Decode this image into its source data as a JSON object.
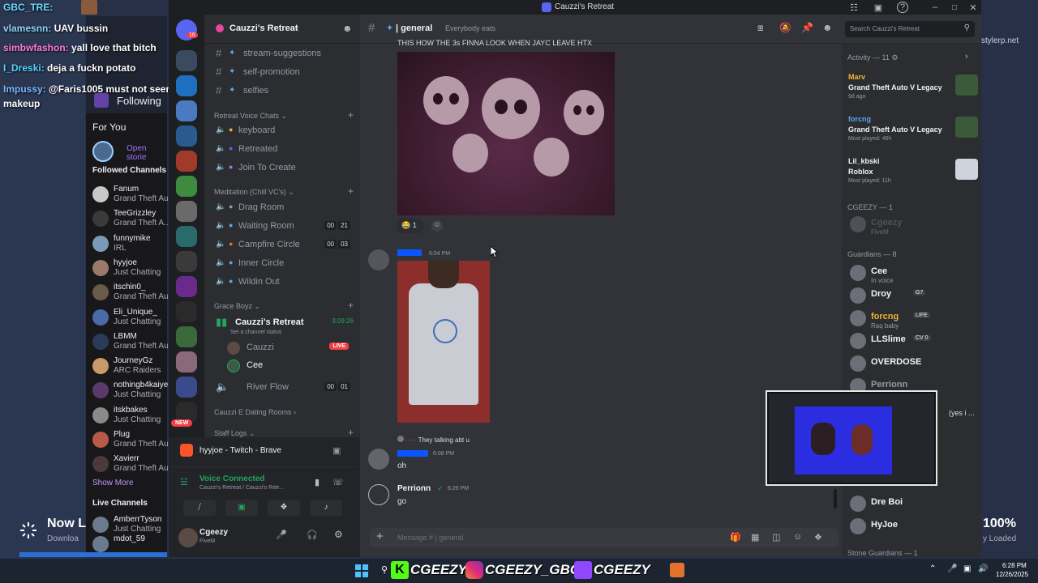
{
  "overlay_chat": [
    {
      "user": "GBC_TRE:",
      "msg": ""
    },
    {
      "user": "vlamesnn:",
      "msg": "UAV bussin"
    },
    {
      "user": "simbwfashon:",
      "msg": "yall love that bitch"
    },
    {
      "user": "I_Dreski:",
      "msg": "deja a fuckn potato"
    },
    {
      "user": "Impussy:",
      "msg": "@Faris1005 must not seen her without makeup"
    }
  ],
  "twitch": {
    "following_label": "Following",
    "for_you_label": "For You",
    "open_stories_label": "Open storie",
    "followed_channels_label": "Followed Channels",
    "channels": [
      {
        "name": "Fanum",
        "game": "Grand Theft Au"
      },
      {
        "name": "TeeGrizzley",
        "game": "Grand Theft A..."
      },
      {
        "name": "funnymike",
        "game": "IRL"
      },
      {
        "name": "hyyjoe",
        "game": "Just Chatting"
      },
      {
        "name": "itschin0_",
        "game": "Grand Theft Au"
      },
      {
        "name": "Eli_Unique_",
        "game": "Just Chatting"
      },
      {
        "name": "LBMM",
        "game": "Grand Theft Au"
      },
      {
        "name": "JourneyGz",
        "game": "ARC Raiders"
      },
      {
        "name": "nothingb4kaiye",
        "game": "Just Chatting"
      },
      {
        "name": "itskbakes",
        "game": "Just Chatting"
      },
      {
        "name": "Plug",
        "game": "Grand Theft Au"
      },
      {
        "name": "Xavierr",
        "game": "Grand Theft Au"
      }
    ],
    "show_more_label": "Show More",
    "live_channels_label": "Live Channels",
    "live_channels": [
      {
        "name": "AmberrTyson",
        "game": "Just Chatting"
      },
      {
        "name": "mdot_59",
        "game": ""
      }
    ],
    "now_live_label": "Now L",
    "download_label": "Downloa",
    "percent_label": "100%",
    "loaded_label": "y Loaded",
    "stylerp_label": "stylerp.net"
  },
  "window": {
    "title": "Cauzzi's Retreat"
  },
  "server": {
    "name": "Cauzzi's Retreat"
  },
  "guild_badge": "16",
  "new_badge": "NEW",
  "channels": {
    "top": [
      {
        "name": "stream-suggestions"
      },
      {
        "name": "self-promotion"
      },
      {
        "name": "selfies"
      }
    ],
    "cat_voice": "Retreat Voice Chats",
    "voice": [
      {
        "name": "keyboard"
      },
      {
        "name": "Retreated"
      },
      {
        "name": "Join To Create"
      }
    ],
    "cat_meditation": "Meditation (Chill VC's)",
    "meditation": [
      {
        "name": "Drag Room",
        "a": "",
        "b": ""
      },
      {
        "name": "Waiting Room",
        "a": "00",
        "b": "21"
      },
      {
        "name": "Campfire Circle",
        "a": "00",
        "b": "03"
      },
      {
        "name": "Inner Circle",
        "a": "",
        "b": ""
      },
      {
        "name": "Wildin Out",
        "a": "",
        "b": ""
      }
    ],
    "cat_grace": "Grace Boyz",
    "active_vc": {
      "name": "Cauzzi's Retreat",
      "time": "3:09:26",
      "status": "Set a channel status"
    },
    "vc_users": [
      {
        "name": "Cauzzi",
        "live": "LIVE"
      },
      {
        "name": "Cee",
        "live": ""
      }
    ],
    "river": {
      "name": "River Flow",
      "a": "00",
      "b": "01"
    },
    "cat_dating": "Cauzzi E Dating Rooms",
    "cat_staff": "Staff Logs"
  },
  "userbar": {
    "app": "hyyjoe - Twitch - Brave",
    "voice_status": "Voice Connected",
    "voice_location": "Cauzzi's Retreat / Cauzzi's Retr...",
    "username": "Cgeezy",
    "user_status": "FiveM"
  },
  "header": {
    "channel": "| general",
    "topic": "Everybody eats",
    "search_placeholder": "Search Cauzzi's Retreat"
  },
  "messages": {
    "caption": "THIS HOW THE 3s FINNA LOOK WHEN JAYC LEAVE HTX",
    "reaction_count": "1",
    "msg1_time": "6:04 PM",
    "reply_text": "They talking abt u",
    "msg2_time": "6:08 PM",
    "msg2_text": "oh",
    "msg3_author": "Perrionn",
    "msg3_time": "6:26 PM",
    "msg3_text": "go"
  },
  "composer": {
    "placeholder": "Message #  | general"
  },
  "members": {
    "activity_label": "Activity — 11",
    "activities": [
      {
        "user": "Marv",
        "game": "Grand Theft Auto V Legacy",
        "meta": "9d ago"
      },
      {
        "user": "forcng",
        "game": "Grand Theft Auto V Legacy",
        "meta": "Most played: 46h"
      },
      {
        "user": "Lil_kbski",
        "game": "Roblox",
        "meta": "Most played: 11h"
      }
    ],
    "cgeezy_label": "CGEEZY — 1",
    "cgeezy_user": {
      "name": "Cgeezy",
      "status": "FiveM"
    },
    "guardians_label": "Guardians — 8",
    "guardians": [
      {
        "name": "Cee",
        "status": "In voice",
        "tag": ""
      },
      {
        "name": "Droy",
        "status": "",
        "tag": "G7"
      },
      {
        "name": "forcng",
        "status": "Raq baby",
        "tag": "LIFE"
      },
      {
        "name": "LLSlime",
        "status": "",
        "tag": "CV 0"
      },
      {
        "name": "OVERDOSE",
        "status": "",
        "tag": ""
      },
      {
        "name": "Perrionn",
        "status": "",
        "tag": ""
      }
    ],
    "partial_text": "(yes i ...",
    "more": [
      {
        "name": "Dre Boi"
      },
      {
        "name": "HyJoe"
      }
    ],
    "stone_label": "Stone Guardians — 1"
  },
  "taskbar": {
    "tag1": "CGEEZY",
    "tag2": "CGEEZY_GBC",
    "tag3": "CGEEZY",
    "time": "6:28 PM",
    "date": "12/26/2025"
  }
}
